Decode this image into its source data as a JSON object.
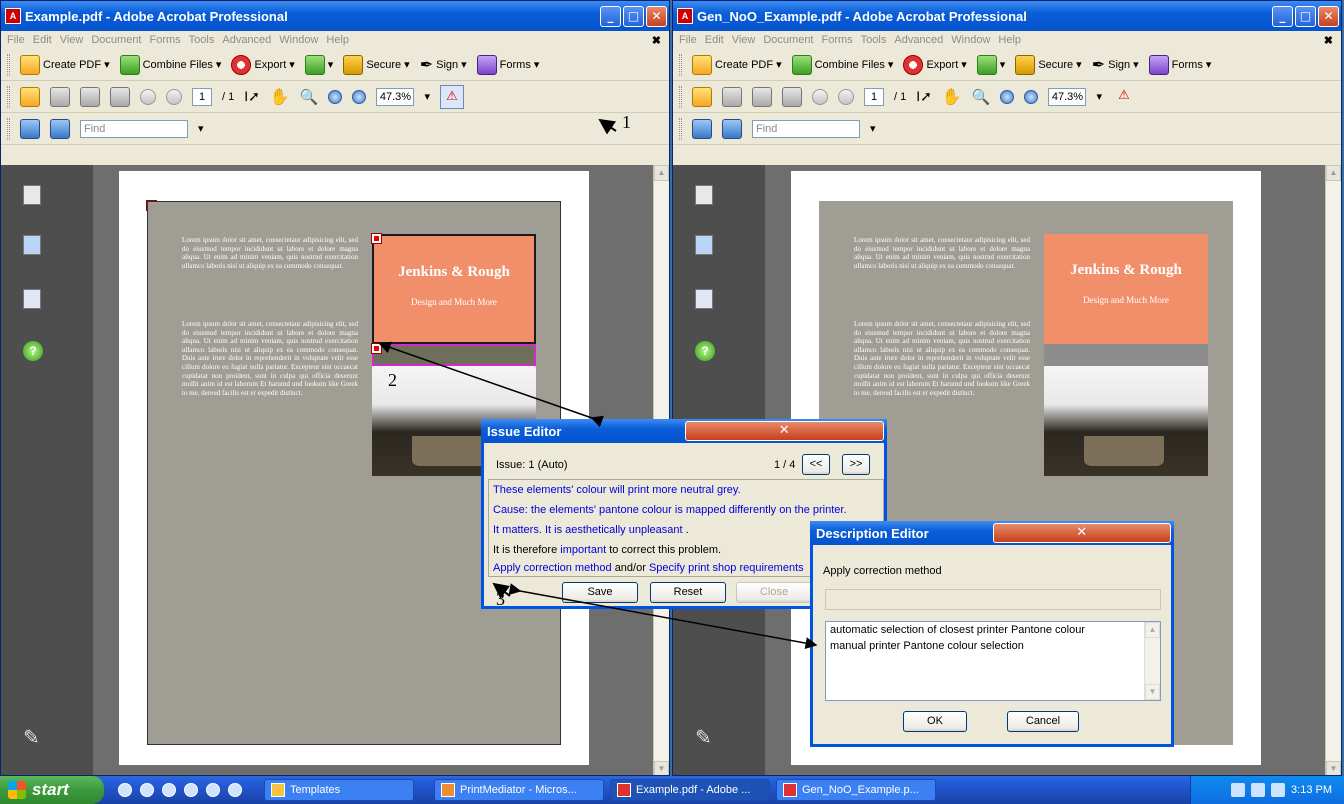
{
  "windows": [
    {
      "title": "Example.pdf - Adobe Acrobat Professional",
      "menu": [
        "File",
        "Edit",
        "View",
        "Document",
        "Forms",
        "Tools",
        "Advanced",
        "Window",
        "Help"
      ],
      "toolbar": {
        "create_pdf": "Create PDF",
        "combine": "Combine Files",
        "export": "Export",
        "secure": "Secure",
        "sign": "Sign",
        "forms": "Forms"
      },
      "page_current": "1",
      "page_total": "/ 1",
      "zoom": "47.3%",
      "find_placeholder": "Find"
    },
    {
      "title": "Gen_NoO_Example.pdf - Adobe Acrobat Professional",
      "menu": [
        "File",
        "Edit",
        "View",
        "Document",
        "Forms",
        "Tools",
        "Advanced",
        "Window",
        "Help"
      ],
      "toolbar": {
        "create_pdf": "Create PDF",
        "combine": "Combine Files",
        "export": "Export",
        "secure": "Secure",
        "sign": "Sign",
        "forms": "Forms"
      },
      "page_current": "1",
      "page_total": "/ 1",
      "zoom": "47.3%",
      "find_placeholder": "Find"
    }
  ],
  "document": {
    "lorem1": "Lorem ipsum dolor sit amet, consectetaur adipisicing elit, sed do eiusmod tempor incididunt ut labore et dolore magna aliqua. Ut enim ad minim veniam, quis nostrud exercitation ullamco laboris nisi ut aliquip ex ea commodo consequat.",
    "lorem2": "Lorem ipsum dolor sit amet, consectetaur adipisicing elit, sed do eiusmod tempor incididunt ut labore et dolore magna aliqua. Ut enim ad minim veniam, quis nostrud exercitation ullamco laboris nisi ut aliquip ex ea commodo consequat. Duis aute irure dolor in reprehenderit in voluptate velit esse cillum dolore eu fugiat nulla pariatur. Excepteur sint occaecat cupidatat non proident, sunt in culpa qui officia deserunt mollit anim id est laborum Et harumd und lookum like Greek to me, dereud facilis est er expedit distinct.",
    "brand": "Jenkins & Rough",
    "tagline": "Design and Much More"
  },
  "issue_editor": {
    "title": "Issue Editor",
    "issue_label": "Issue:  1 (Auto)",
    "counter": "1 / 4",
    "prev": "<<",
    "next": ">>",
    "line1": "These elements' colour will print more neutral grey.",
    "line2": "Cause: the elements' pantone colour is mapped differently on the printer.",
    "line3a": "It matters.",
    "line3b": "It is aesthetically unpleasant",
    "line3c": ".",
    "line4a": "It is therefore",
    "line4b": "important",
    "line4c": "to correct this problem.",
    "line5a": "Apply correction method",
    "line5b": "and/or",
    "line5c": "Specify print shop requirements",
    "save": "Save",
    "reset": "Reset",
    "close": "Close"
  },
  "description_editor": {
    "title": "Description Editor",
    "label": "Apply correction method",
    "options": [
      "automatic selection of closest printer Pantone colour",
      "manual printer Pantone colour selection"
    ],
    "ok": "OK",
    "cancel": "Cancel"
  },
  "annotations": [
    "1",
    "2",
    "3"
  ],
  "taskbar": {
    "start": "start",
    "tasks": [
      "Templates",
      "PrintMediator - Micros...",
      "Example.pdf - Adobe ...",
      "Gen_NoO_Example.p..."
    ],
    "clock": "3:13 PM"
  },
  "colors": {
    "titlebar": "#0a5ed7",
    "salmon": "#f28f6b",
    "warning": "#d00000",
    "link": "#0000e0"
  }
}
